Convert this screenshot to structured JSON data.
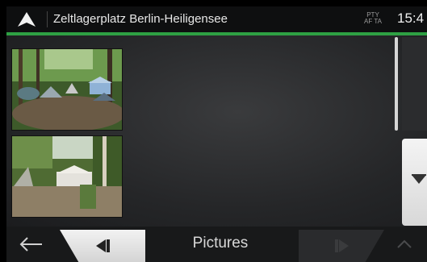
{
  "header": {
    "title": "Zeltlagerplatz Berlin-Heiligensee",
    "radio_line1": "PTY",
    "radio_line2": "AF TA",
    "clock": "15:4"
  },
  "footer": {
    "label": "Pictures"
  },
  "icons": {
    "navigation": "navigation-arrow-icon",
    "back": "back-arrow-icon",
    "prev": "previous-page-icon",
    "next": "next-page-icon",
    "scroll_down": "scroll-down-icon",
    "up": "chevron-up-icon"
  },
  "colors": {
    "accent": "#2ea043",
    "header_bg": "#0e0f10",
    "content_bg": "#252628"
  },
  "pictures": [
    {
      "kind": "campsite-with-tents"
    },
    {
      "kind": "campsite-with-large-tent"
    }
  ]
}
